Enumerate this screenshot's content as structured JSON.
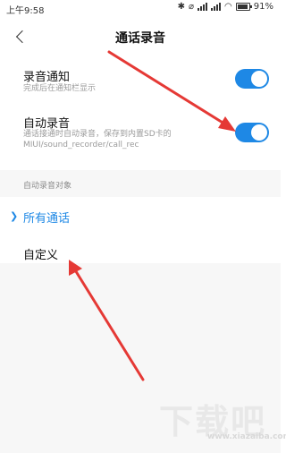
{
  "status_bar": {
    "time": "上午9:58",
    "battery": "91%",
    "icons": [
      "bluetooth-icon",
      "mute-icon",
      "signal-icon",
      "signal-icon",
      "wifi-icon",
      "battery-icon"
    ]
  },
  "header": {
    "title": "通话录音",
    "back_icon": "back-chevron-icon"
  },
  "settings": {
    "record_notice": {
      "label": "录音通知",
      "sub": "完成后在通知栏显示",
      "enabled": true
    },
    "auto_record": {
      "label": "自动录音",
      "sub": "通话接通时自动录音，保存到内置SD卡的MIUI/sound_recorder/call_rec",
      "enabled": true
    }
  },
  "section": {
    "title": "自动录音对象"
  },
  "options": {
    "all_calls": "所有通话",
    "custom": "自定义"
  },
  "colors": {
    "accent": "#1e88e5",
    "annotation_arrow": "#e53935"
  },
  "watermark": {
    "big": "下载吧",
    "small": "www.xiazaiba.com"
  }
}
